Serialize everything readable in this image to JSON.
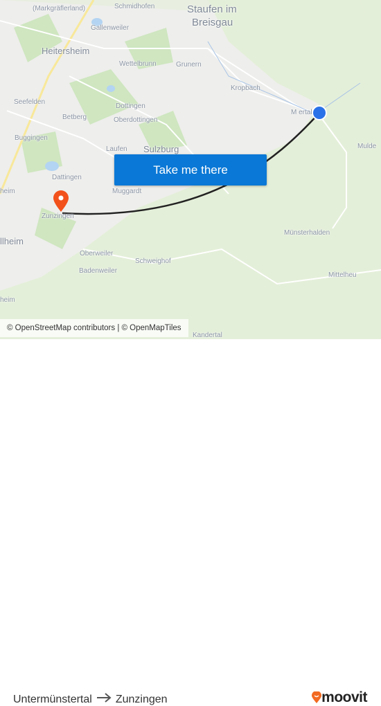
{
  "map": {
    "labels": {
      "eschbach": "(Markgräflerland)",
      "schmidhofen": "Schmidhofen",
      "staufen1": "Staufen im",
      "staufen2": "Breisgau",
      "gallenweiler": "Gallenweiler",
      "heitersheim": "Heitersheim",
      "wettelbrunn": "Wettelbrunn",
      "grunern": "Grunern",
      "kropbach": "Kropbach",
      "muenstertal": "M      ertal",
      "seefelden": "Seefelden",
      "dottingen": "Dottingen",
      "betberg": "Betberg",
      "oberdottingen": "Oberdottingen",
      "buggingen": "Buggingen",
      "laufen": "Laufen",
      "sulzburg": "Sulzburg",
      "mulden": "Mulde",
      "dattingen": "Dattingen",
      "muggardt": "Muggardt",
      "heim": "heim",
      "zunzingen": "Zunzingen",
      "muellheim": "llheim",
      "muensterhalden": "Münsterhalden",
      "oberweiler": "Oberweiler",
      "schweighof": "Schweighof",
      "badenweiler": "Badenweiler",
      "mittelheu": "Mittelheu",
      "heim2": "heim",
      "kandertal": "Kandertal"
    },
    "route_color": "#222222",
    "origin_color": "#2a72e8",
    "destination_color": "#f2511b",
    "cta_label": "Take me there",
    "attribution": "© OpenStreetMap contributors | © OpenMapTiles"
  },
  "footer": {
    "origin": "Untermünstertal",
    "destination": "Zunzingen",
    "brand": "moovit",
    "brand_color": "#f26a21"
  }
}
